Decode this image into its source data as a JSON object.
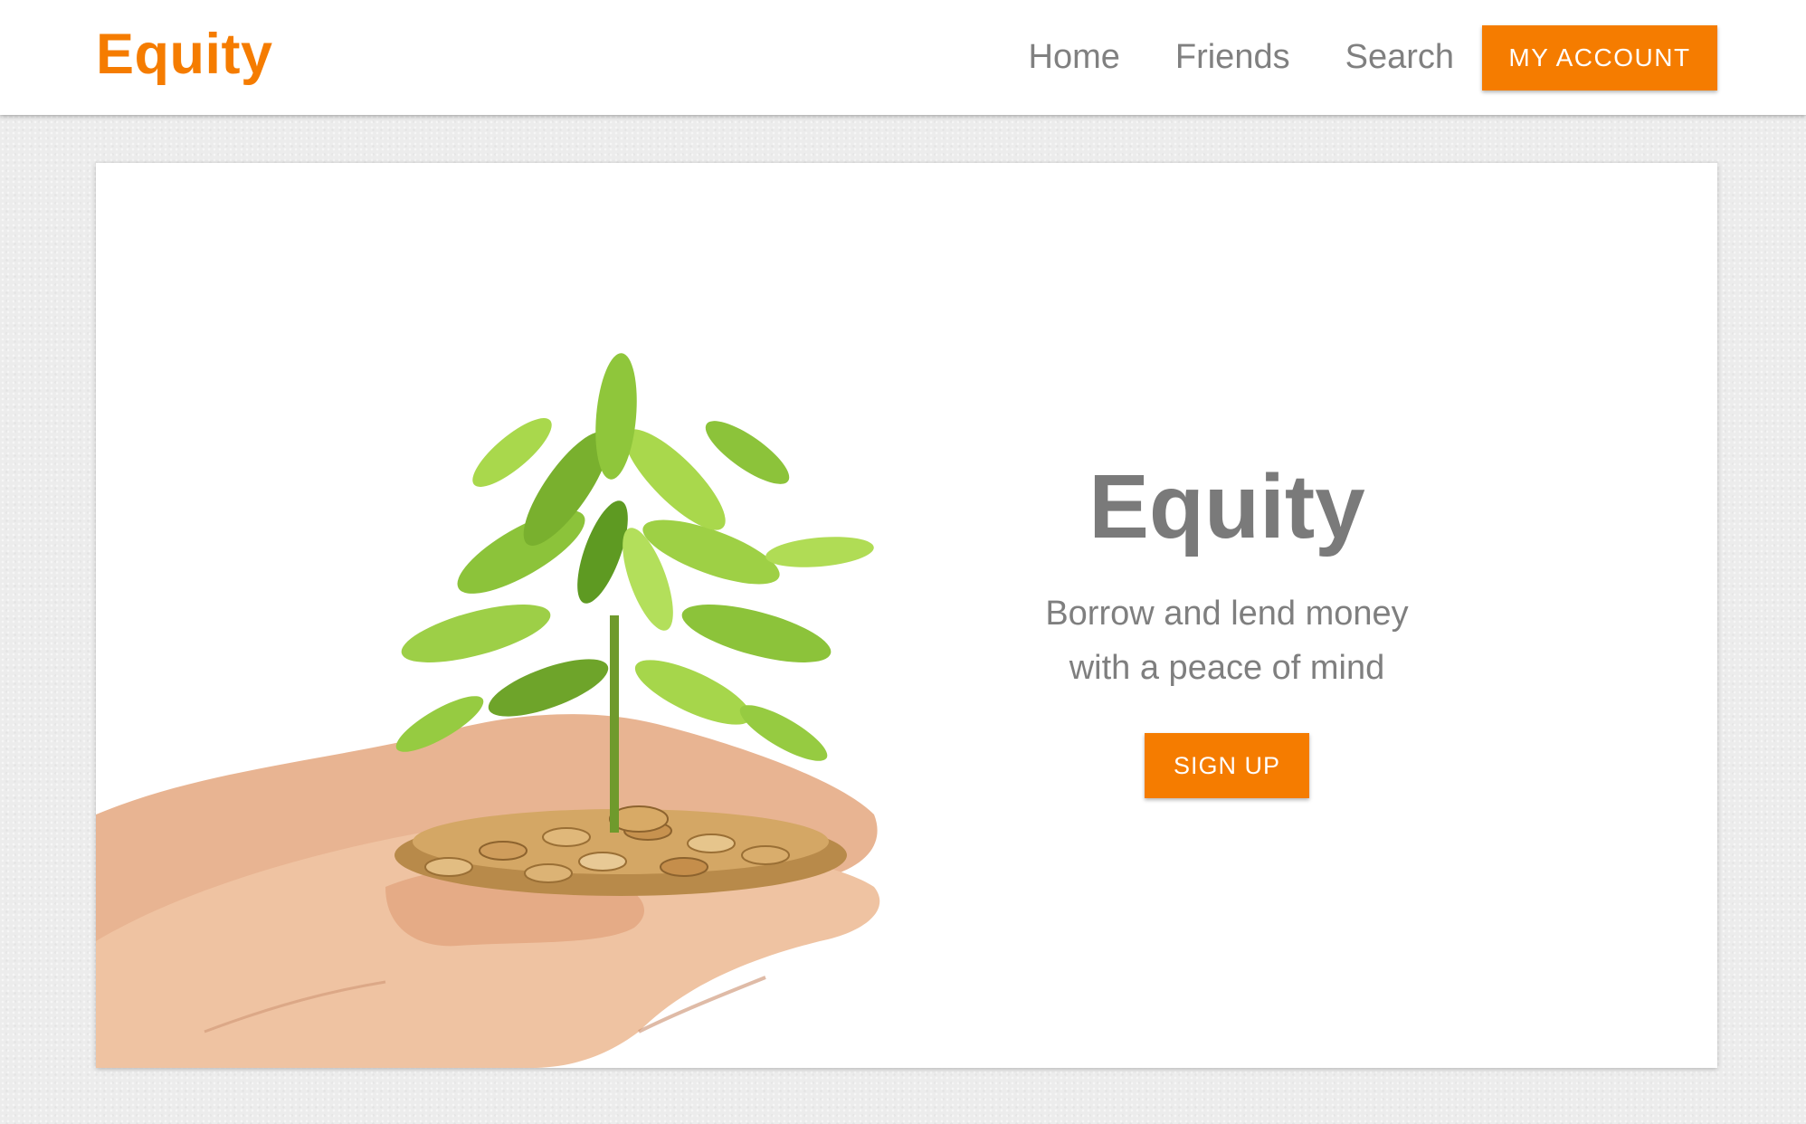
{
  "colors": {
    "accent": "#f57c00",
    "text_muted": "#7f7f7f",
    "page_bg": "#ececec",
    "card_bg": "#ffffff",
    "leaf_light": "#a5d63f",
    "leaf_dark": "#5a9a1e",
    "skin": "#e9b896",
    "coin": "#c99a55"
  },
  "navbar": {
    "brand": "Equity",
    "links": [
      {
        "label": "Home"
      },
      {
        "label": "Friends"
      },
      {
        "label": "Search"
      }
    ],
    "account_button": "MY ACCOUNT"
  },
  "hero": {
    "image_subject": "hands-holding-coins-with-plant-image",
    "title": "Equity",
    "subtitle_line1": "Borrow and lend money",
    "subtitle_line2": "with a peace of mind",
    "cta_button": "SIGN UP"
  }
}
